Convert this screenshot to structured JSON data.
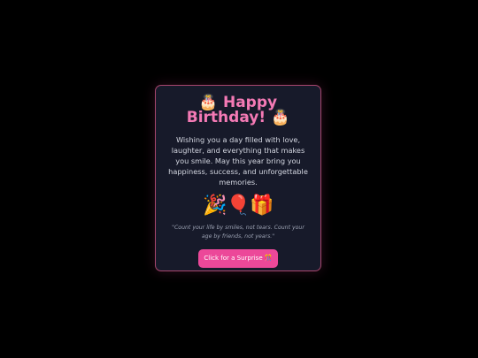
{
  "card": {
    "title_icon": "🎂",
    "title_text": "Happy Birthday!",
    "title_icon_end": "🎂",
    "message": "Wishing you a day filled with love, laughter, and everything that makes you smile. May this year bring you happiness, success, and unforgettable memories.",
    "emojis": {
      "party": "🎉",
      "balloon": "🎈",
      "gift": "🎁"
    },
    "quote": "\"Count your life by smiles, not tears. Count your age by friends, not years.\"",
    "button_label": "Click for a Surprise 🎊"
  },
  "colors": {
    "background": "#000000",
    "card_background": "#171a2a",
    "card_border": "#a8466e",
    "title": "#f47ab5",
    "button": "#ec4899"
  }
}
